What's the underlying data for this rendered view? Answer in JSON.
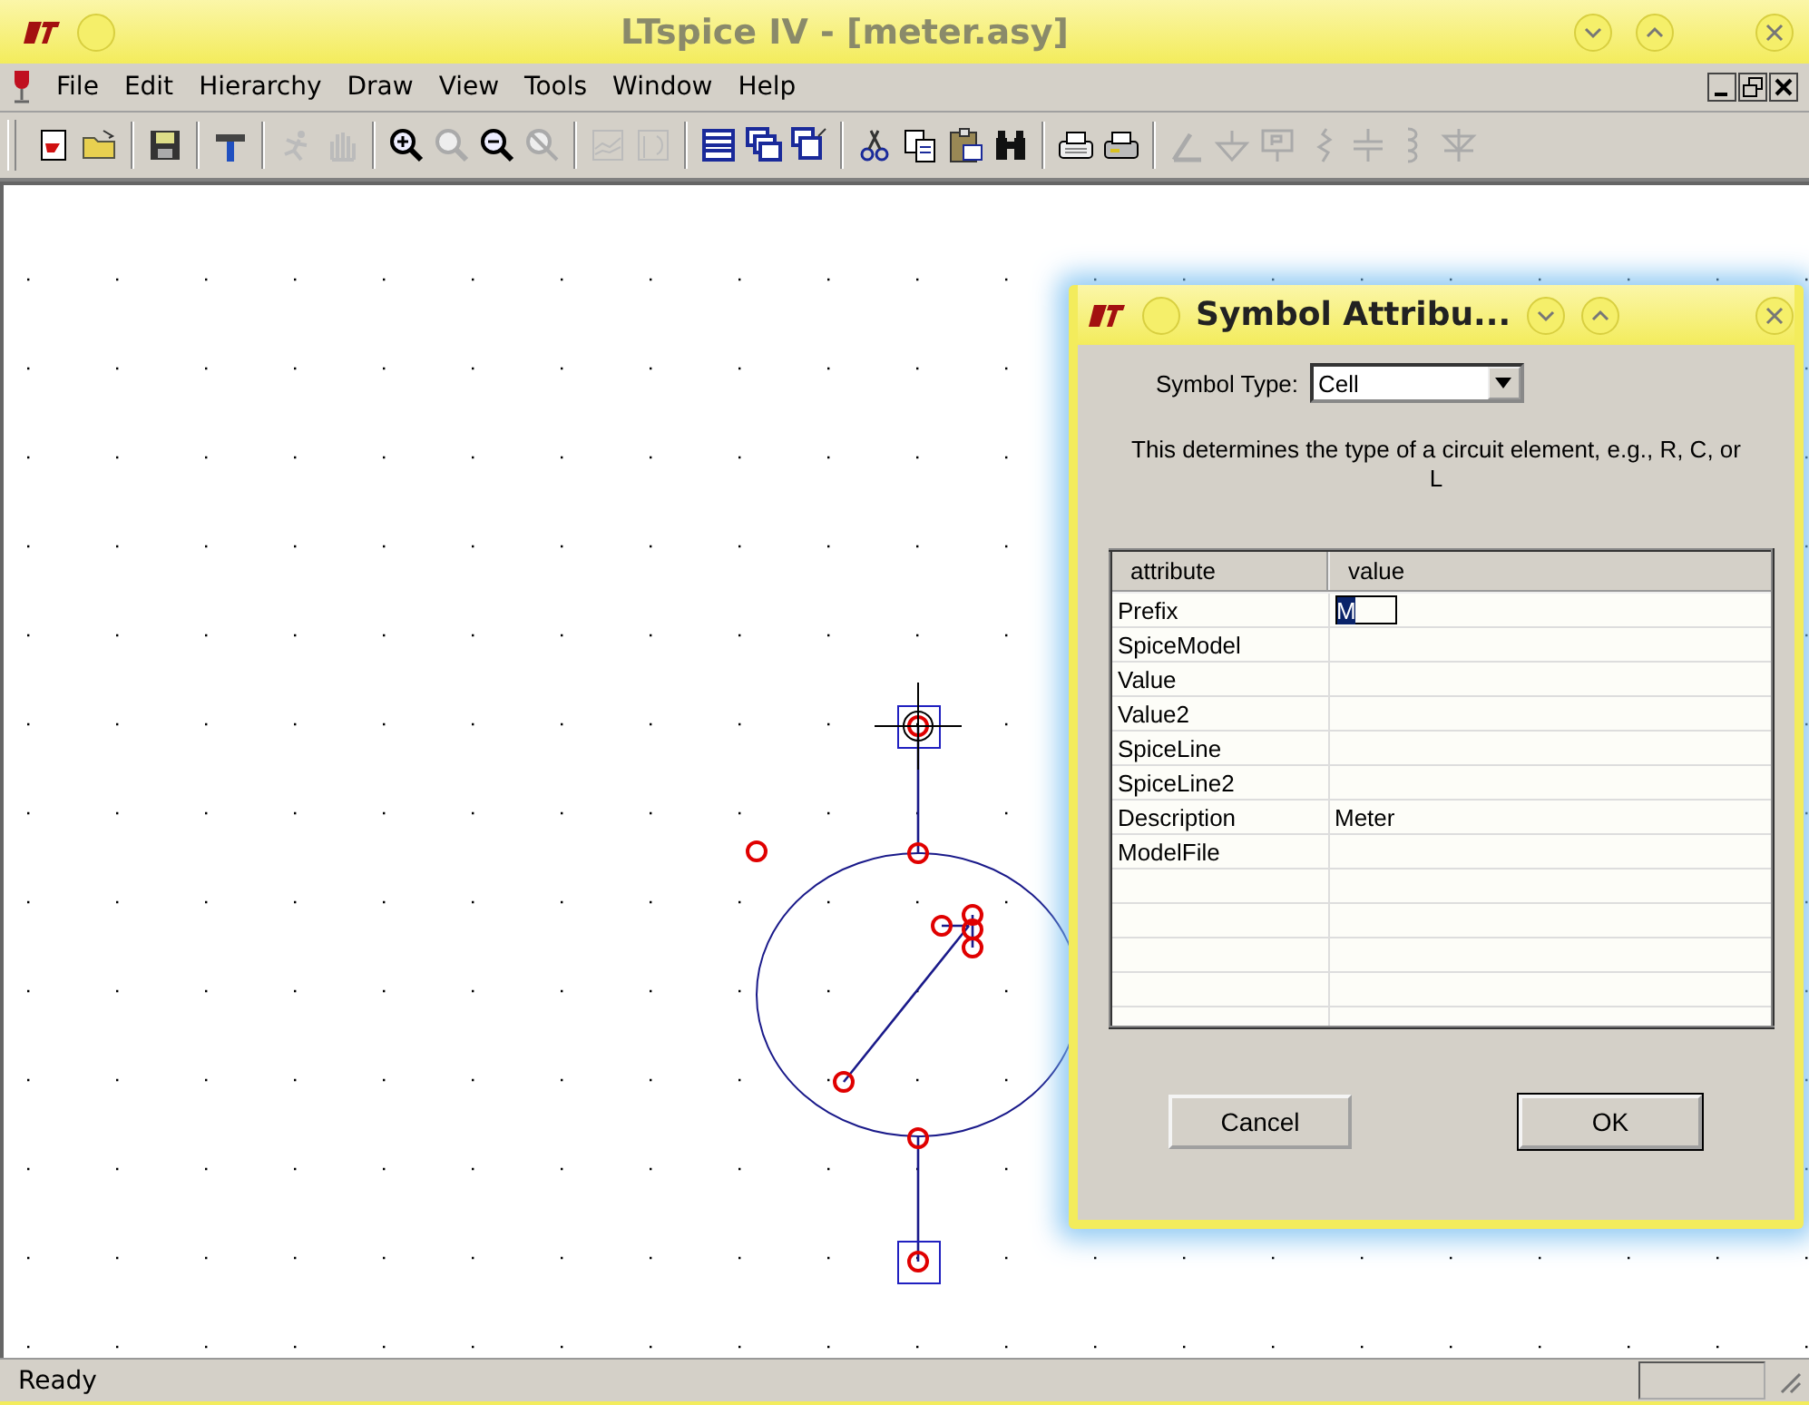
{
  "window": {
    "title": "LTspice IV - [meter.asy]"
  },
  "menu": [
    {
      "label": "File"
    },
    {
      "label": "Edit"
    },
    {
      "label": "Hierarchy"
    },
    {
      "label": "Draw"
    },
    {
      "label": "View"
    },
    {
      "label": "Tools"
    },
    {
      "label": "Window"
    },
    {
      "label": "Help"
    }
  ],
  "dialog": {
    "title": "Symbol Attribu...",
    "symbol_type_label": "Symbol Type:",
    "symbol_type_value": "Cell",
    "description": "This determines the type of a circuit element, e.g., R, C, or L",
    "table": {
      "columns": [
        "attribute",
        "value"
      ],
      "rows": [
        {
          "attribute": "Prefix",
          "value": "M",
          "editing": true
        },
        {
          "attribute": "SpiceModel",
          "value": "",
          "editing": false
        },
        {
          "attribute": "Value",
          "value": "",
          "editing": false
        },
        {
          "attribute": "Value2",
          "value": "",
          "editing": false
        },
        {
          "attribute": "SpiceLine",
          "value": "",
          "editing": false
        },
        {
          "attribute": "SpiceLine2",
          "value": "",
          "editing": false
        },
        {
          "attribute": "Description",
          "value": "Meter",
          "editing": false
        },
        {
          "attribute": "ModelFile",
          "value": "",
          "editing": false
        }
      ]
    },
    "buttons": [
      {
        "label": "Cancel",
        "default": false
      },
      {
        "label": "OK",
        "default": true
      }
    ]
  },
  "status_bar": {
    "text": "Ready"
  }
}
